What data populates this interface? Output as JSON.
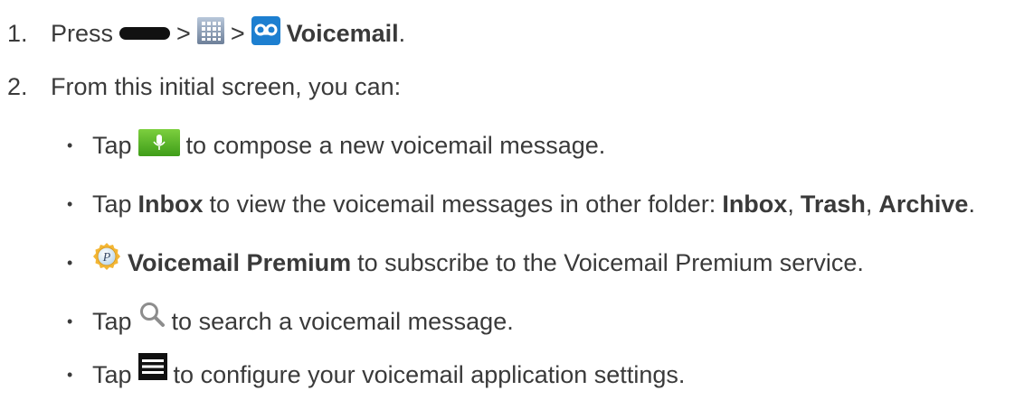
{
  "steps": [
    {
      "number": "1.",
      "press": "Press",
      "sep1": ">",
      "sep2": ">",
      "target": "Voicemail",
      "end": "."
    },
    {
      "number": "2.",
      "text": "From this initial screen, you can:"
    }
  ],
  "bullets": {
    "compose": {
      "tap": "Tap",
      "rest": "to compose a new voicemail message."
    },
    "inbox": {
      "tap": "Tap",
      "inbox": "Inbox",
      "rest": "to view the voicemail messages in other folder:",
      "f1": "Inbox",
      "c1": ",",
      "f2": "Trash",
      "c2": ",",
      "f3": "Archive",
      "end": "."
    },
    "premium": {
      "name": "Voicemail Premium",
      "rest": "to subscribe to the Voicemail Premium service."
    },
    "search": {
      "tap": "Tap",
      "rest": "to search a voicemail message."
    },
    "menu": {
      "tap": "Tap",
      "rest": "to configure your voicemail application settings."
    }
  },
  "bullet_glyph": "•",
  "icons": {
    "home_key": "home-key-icon",
    "apps": "apps-grid-icon",
    "voicemail": "voicemail-app-icon",
    "compose": "microphone-compose-icon",
    "premium": "voicemail-premium-icon",
    "search": "search-icon",
    "menu": "menu-icon"
  },
  "colors": {
    "text": "#3a3a3a",
    "compose_green": "#5cb82a",
    "menu_black": "#111111"
  }
}
